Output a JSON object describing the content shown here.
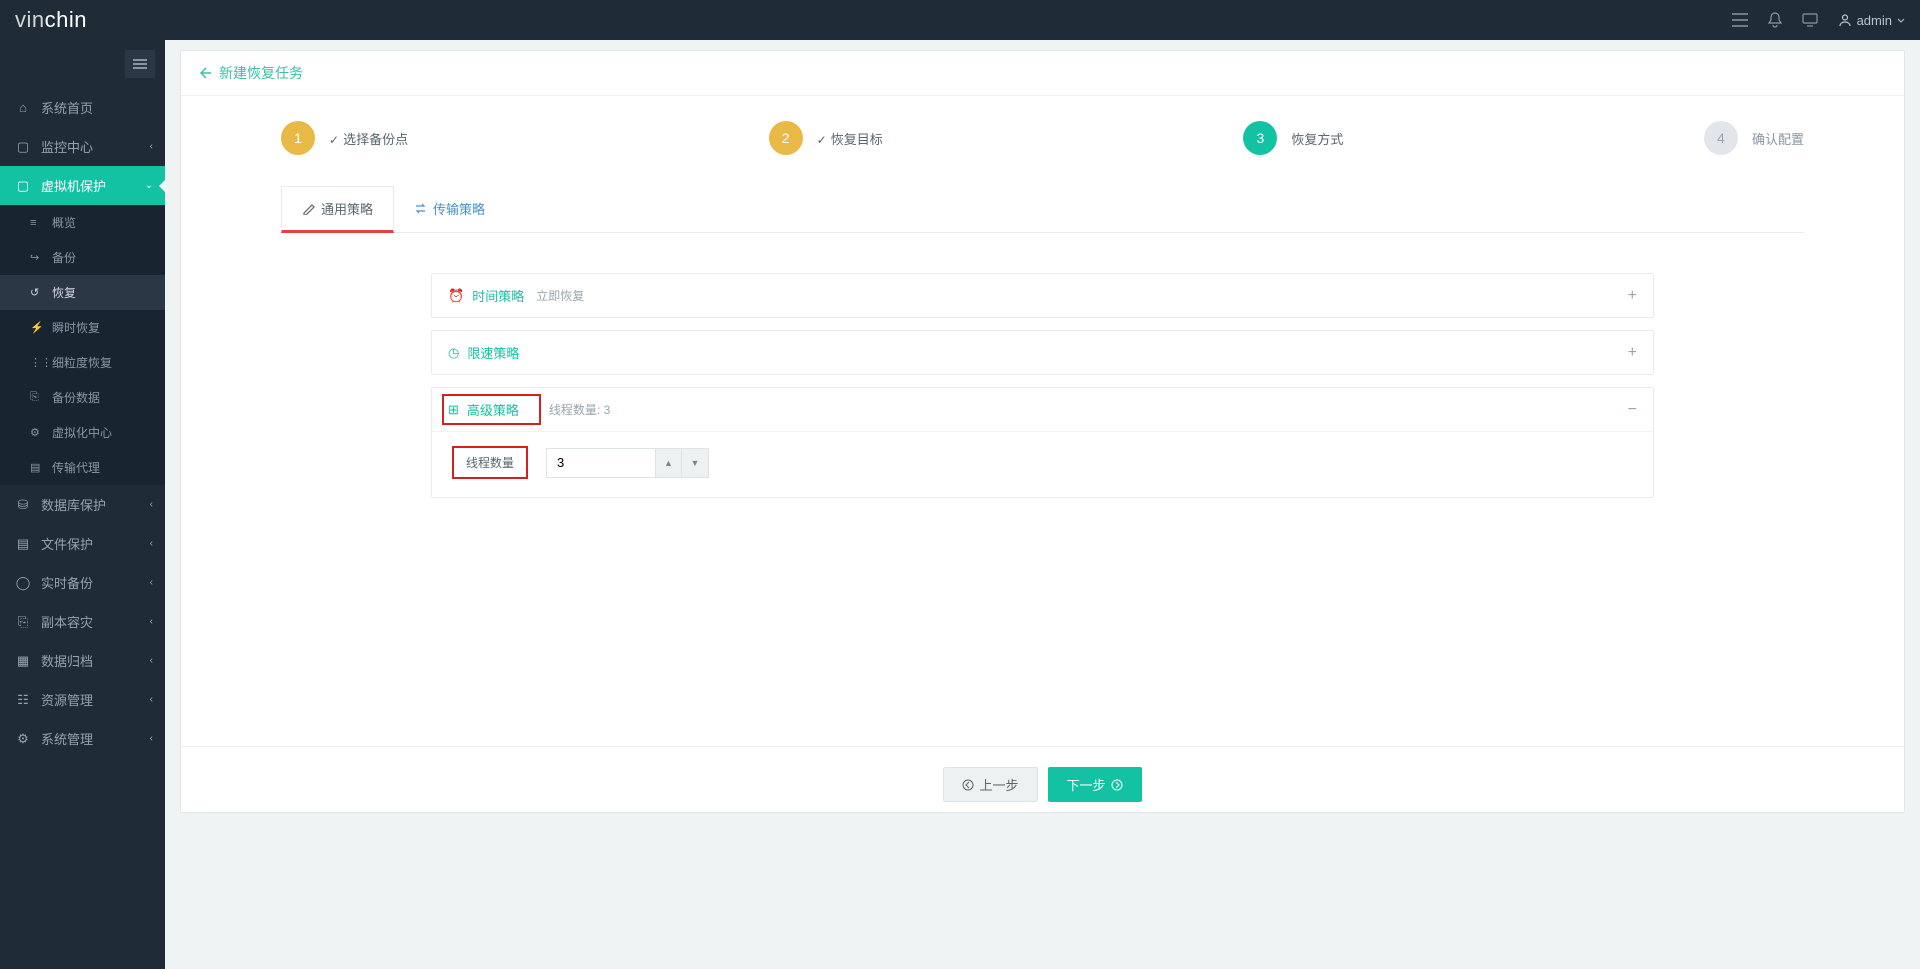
{
  "brand": {
    "part1": "vin",
    "part2": "chin"
  },
  "header": {
    "user": "admin"
  },
  "sidebar": {
    "items": [
      {
        "icon": "home",
        "label": "系统首页",
        "expand": false
      },
      {
        "icon": "monitor",
        "label": "监控中心",
        "expand": true
      },
      {
        "icon": "monitor",
        "label": "虚拟机保护",
        "expand": true,
        "active": true
      },
      {
        "icon": "db",
        "label": "数据库保护",
        "expand": true
      },
      {
        "icon": "file",
        "label": "文件保护",
        "expand": true
      },
      {
        "icon": "shield",
        "label": "实时备份",
        "expand": true
      },
      {
        "icon": "copy",
        "label": "副本容灾",
        "expand": true
      },
      {
        "icon": "archive",
        "label": "数据归档",
        "expand": true
      },
      {
        "icon": "res",
        "label": "资源管理",
        "expand": true
      },
      {
        "icon": "gear",
        "label": "系统管理",
        "expand": true
      }
    ],
    "sub": [
      {
        "label": "概览"
      },
      {
        "label": "备份"
      },
      {
        "label": "恢复",
        "sel": true
      },
      {
        "label": "瞬时恢复"
      },
      {
        "label": "细粒度恢复"
      },
      {
        "label": "备份数据"
      },
      {
        "label": "虚拟化中心"
      },
      {
        "label": "传输代理"
      }
    ]
  },
  "page": {
    "title": "新建恢复任务"
  },
  "steps": [
    {
      "num": "1",
      "label": "选择备份点",
      "state": "done",
      "check": true
    },
    {
      "num": "2",
      "label": "恢复目标",
      "state": "done",
      "check": true
    },
    {
      "num": "3",
      "label": "恢复方式",
      "state": "cur"
    },
    {
      "num": "4",
      "label": "确认配置",
      "state": "pend"
    }
  ],
  "tabs": [
    {
      "label": "通用策略",
      "active": true
    },
    {
      "label": "传输策略",
      "active": false
    }
  ],
  "strategies": {
    "time": {
      "title": "时间策略",
      "sub": "立即恢复"
    },
    "speed": {
      "title": "限速策略",
      "sub": ""
    },
    "adv": {
      "title": "高级策略",
      "sub": "线程数量: 3"
    }
  },
  "form": {
    "thread_label": "线程数量",
    "thread_value": "3"
  },
  "footer": {
    "prev": "上一步",
    "next": "下一步"
  }
}
